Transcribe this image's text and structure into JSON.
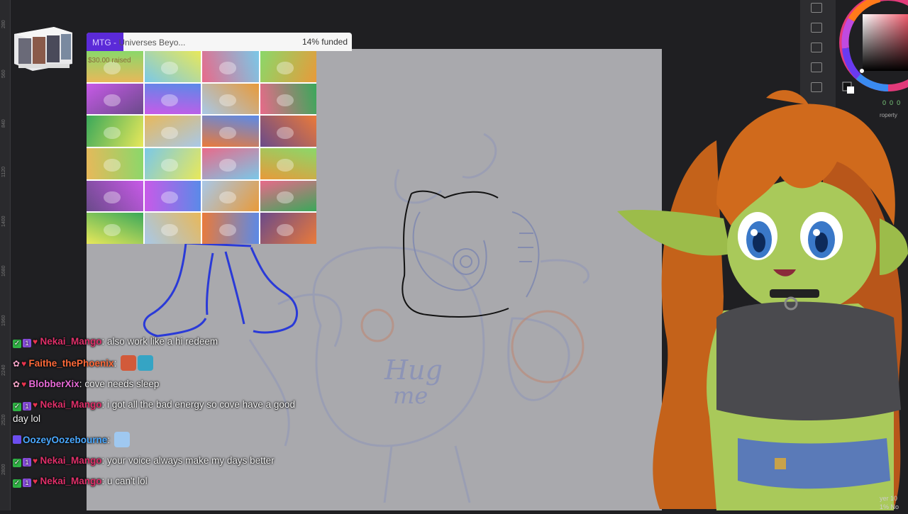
{
  "goal": {
    "title_prefix": "MTG - ",
    "title_rest": "Universes Beyo...",
    "percent_label": "14% funded",
    "progress": 0.14,
    "raised": "$30.00 raised",
    "fill_color": "#5b2ad8"
  },
  "ruler": {
    "ticks": [
      "280",
      "560",
      "840",
      "1120",
      "1400",
      "1680",
      "1960",
      "2240",
      "2520",
      "2800"
    ]
  },
  "sketch": {
    "text_line1": "Hug",
    "text_line2": "me"
  },
  "chat": {
    "messages": [
      {
        "user": "Nekai_Mango",
        "text": "also work like a hi redeem",
        "color": "#e0306a",
        "badges": [
          "check",
          "one",
          "heart"
        ]
      },
      {
        "user": "Faithe_thePhoenix",
        "text": "",
        "color": "#ff6a3a",
        "badges": [
          "flower",
          "heart"
        ],
        "emotes": [
          "#d25a3a",
          "#35a4c4"
        ]
      },
      {
        "user": "BlobberXix",
        "text": "cove needs sleep",
        "color": "#e86ad8",
        "badges": [
          "flower",
          "heart"
        ]
      },
      {
        "user": "Nekai_Mango",
        "text": "i got all the bad energy so cove have a good day lol",
        "color": "#e0306a",
        "badges": [
          "check",
          "one",
          "heart"
        ]
      },
      {
        "user": "OozeyOozebourne",
        "text": "",
        "color": "#4aa8ff",
        "badges": [
          "tw"
        ],
        "emotes": [
          "#9fc8f0"
        ]
      },
      {
        "user": "Nekai_Mango",
        "text": "your voice always make my days better",
        "color": "#e0306a",
        "badges": [
          "check",
          "one",
          "heart"
        ]
      },
      {
        "user": "Nekai_Mango",
        "text": "u can't lol",
        "color": "#e0306a",
        "badges": [
          "check",
          "one",
          "heart"
        ]
      }
    ]
  },
  "panel": {
    "property_label": "roperty",
    "layer_label": "yer 10",
    "normal_label": "1% No",
    "color_values": [
      "0",
      "0",
      "0"
    ]
  },
  "icons": [
    "layer-icon",
    "add-layer-icon",
    "folder-icon",
    "camera-icon",
    "panel-icon"
  ]
}
